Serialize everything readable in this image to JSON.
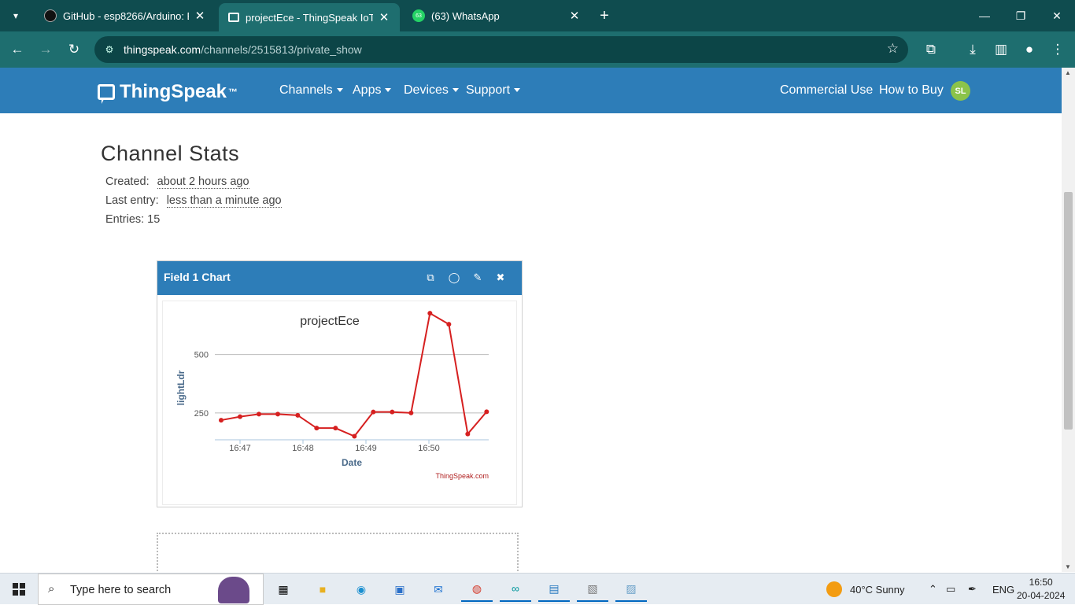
{
  "browser": {
    "tabs": [
      {
        "title": "GitHub - esp8266/Arduino: ESP8266",
        "active": false
      },
      {
        "title": "projectEce - ThingSpeak IoT",
        "active": true
      },
      {
        "title": "(63) WhatsApp",
        "active": false
      }
    ],
    "whatsapp_badge": "63",
    "url_host": "thingspeak.com",
    "url_path": "/channels/2515813/private_show"
  },
  "nav": {
    "logo": "ThingSpeak",
    "logo_tm": "™",
    "items": [
      "Channels",
      "Apps",
      "Devices",
      "Support"
    ],
    "commercial": "Commercial Use",
    "how_to_buy": "How to Buy",
    "avatar": "SL"
  },
  "stats": {
    "heading": "Channel Stats",
    "created_label": "Created:",
    "created_value": "about 2 hours ago",
    "last_entry_label": "Last entry:",
    "last_entry_value": "less than a minute ago",
    "entries": "Entries: 15"
  },
  "panel": {
    "title": "Field 1 Chart"
  },
  "chart_data": {
    "type": "line",
    "title": "projectEce",
    "xlabel": "Date",
    "ylabel": "lightLdr",
    "credit": "ThingSpeak.com",
    "x_ticks": [
      "16:47",
      "16:48",
      "16:49",
      "16:50"
    ],
    "y_ticks": [
      250,
      500
    ],
    "ylim": [
      135,
      600
    ],
    "color": "#d62020",
    "series": [
      {
        "x": [
          "16:46:42",
          "16:46:60",
          "16:47:18",
          "16:47:36",
          "16:47:55",
          "16:48:13",
          "16:48:31",
          "16:48:49",
          "16:49:07",
          "16:49:25",
          "16:49:43",
          "16:50:01",
          "16:50:19",
          "16:50:37",
          "16:50:55"
        ],
        "y": [
          219,
          234,
          245,
          245,
          240,
          185,
          185,
          150,
          254,
          254,
          250,
          677,
          630,
          160,
          255
        ]
      }
    ]
  },
  "taskbar": {
    "search_placeholder": "Type here to search",
    "weather": "40°C  Sunny",
    "lang": "ENG",
    "time": "16:50",
    "date": "20-04-2024"
  }
}
